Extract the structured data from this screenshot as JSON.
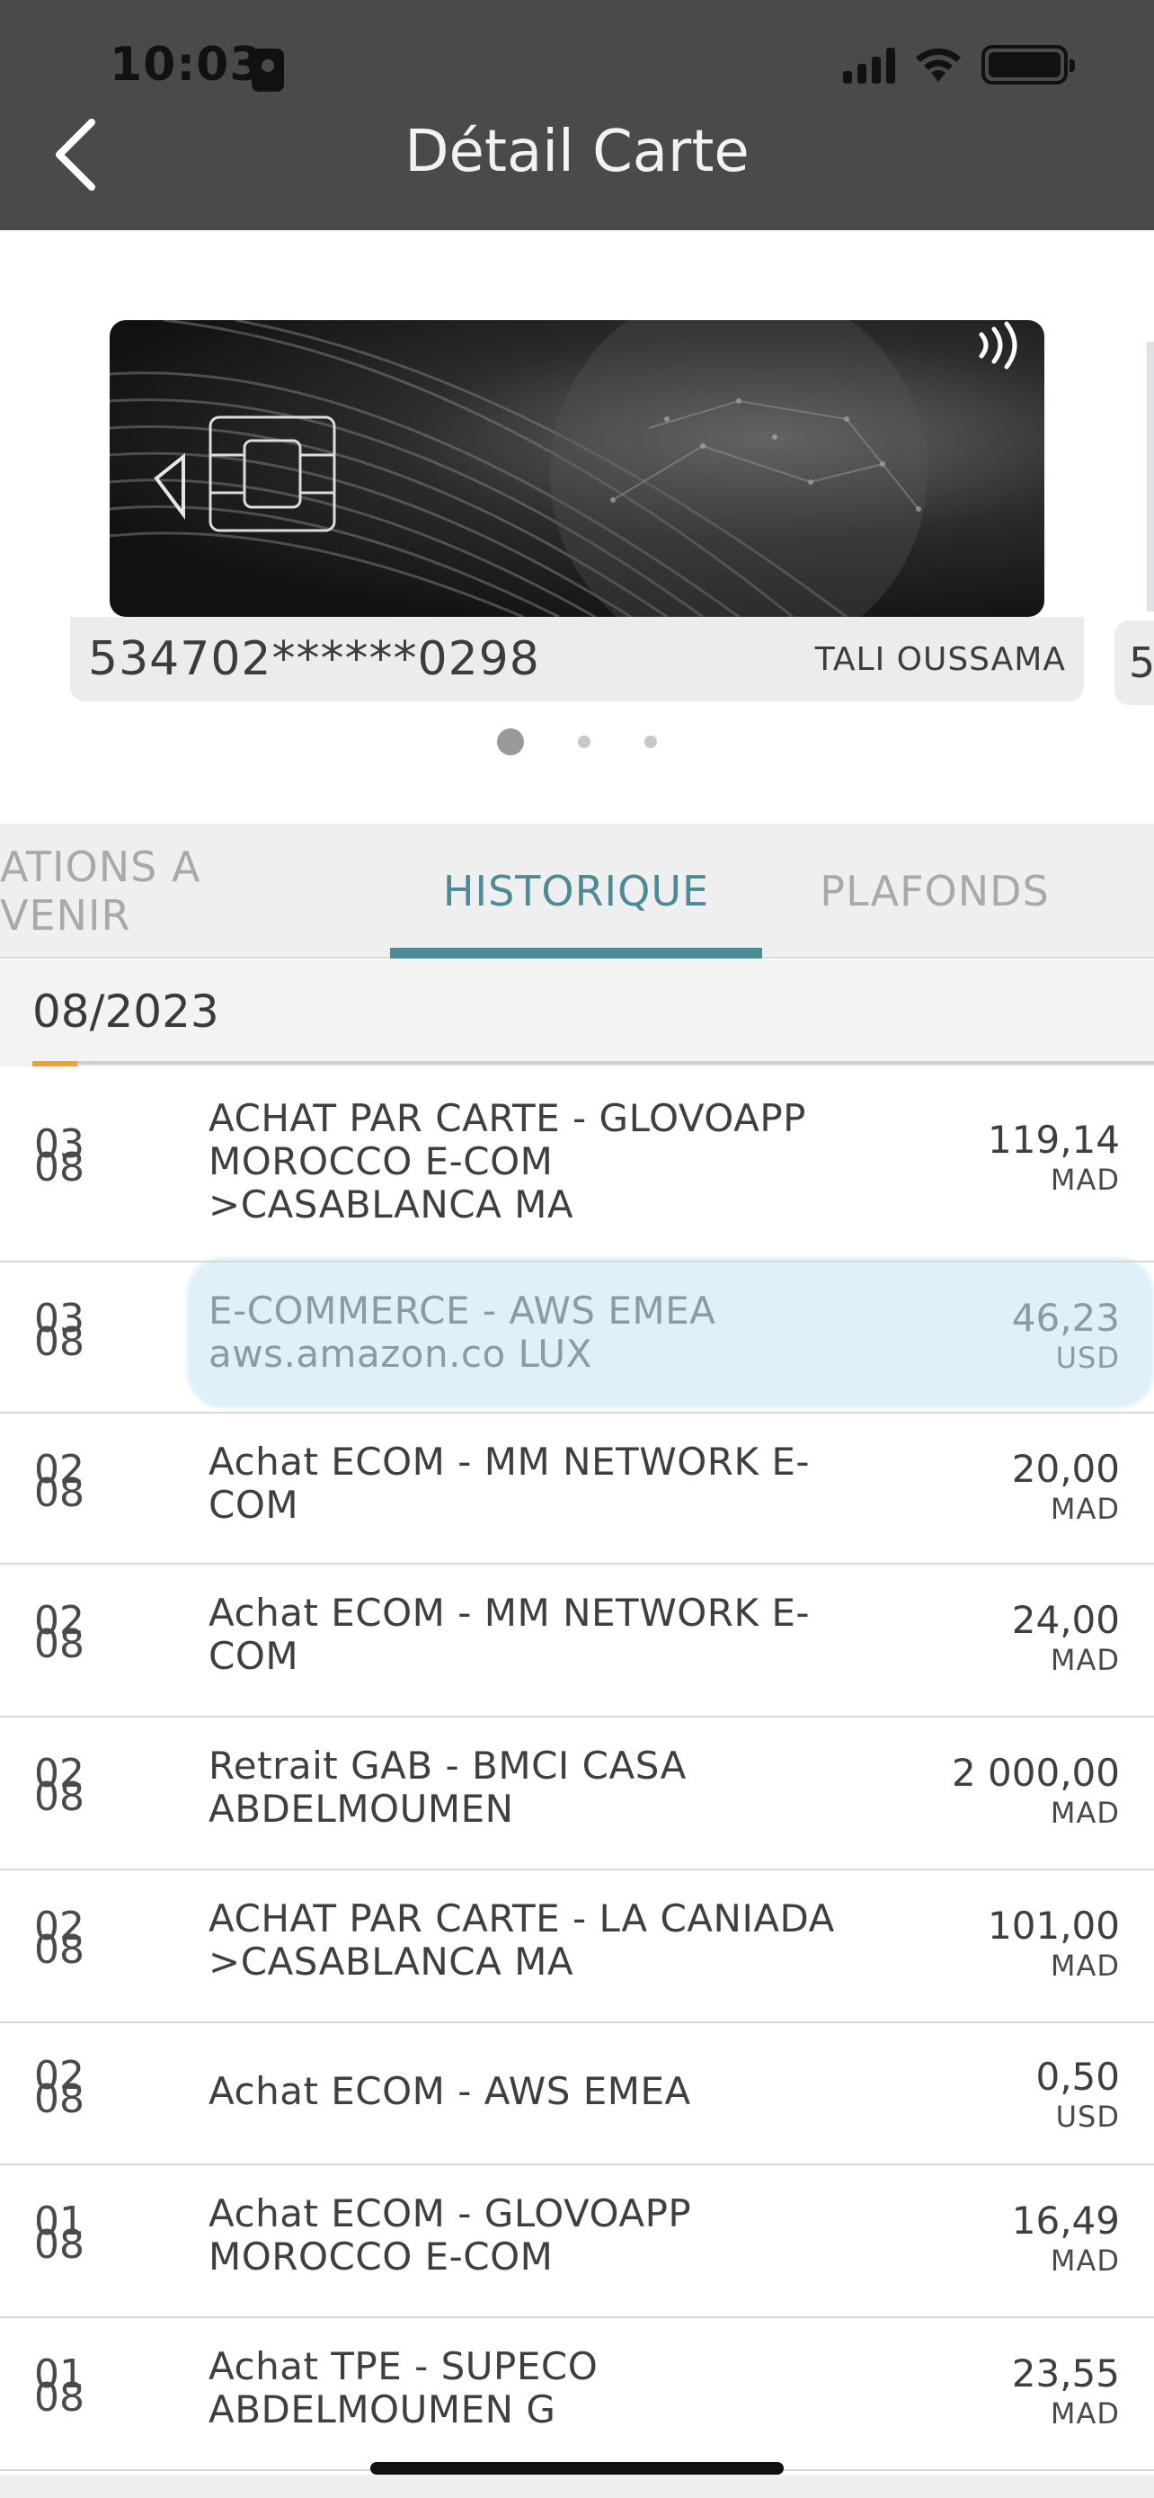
{
  "status_bar": {
    "time": "10:03"
  },
  "header": {
    "title": "Détail Carte"
  },
  "card": {
    "number": "534702******0298",
    "holder": "TALI OUSSAMA",
    "next_card_peek": "5"
  },
  "carousel": {
    "pages": 3,
    "active": 1
  },
  "tabs": [
    {
      "label": "ATIONS A VENIR",
      "active": false
    },
    {
      "label": "HISTORIQUE",
      "active": true
    },
    {
      "label": "PLAFONDS",
      "active": false
    }
  ],
  "section": {
    "period": "08/2023"
  },
  "transactions": [
    {
      "day": "03",
      "month": "08",
      "description": "ACHAT PAR CARTE - GLOVOAPP MOROCCO E-COM  >CASABLANCA MA",
      "amount": "119,14",
      "currency": "MAD"
    },
    {
      "day": "03",
      "month": "08",
      "description": "E-COMMERCE - AWS EMEA aws.amazon.co LUX",
      "amount": "46,23",
      "currency": "USD"
    },
    {
      "day": "02",
      "month": "08",
      "description": "Achat ECOM - MM NETWORK E-COM",
      "amount": "20,00",
      "currency": "MAD"
    },
    {
      "day": "02",
      "month": "08",
      "description": "Achat ECOM - MM NETWORK E-COM",
      "amount": "24,00",
      "currency": "MAD"
    },
    {
      "day": "02",
      "month": "08",
      "description": "Retrait GAB - BMCI CASA ABDELMOUMEN",
      "amount": "2 000,00",
      "currency": "MAD"
    },
    {
      "day": "02",
      "month": "08",
      "description": "ACHAT PAR CARTE - LA CANIADA >CASABLANCA   MA",
      "amount": "101,00",
      "currency": "MAD"
    },
    {
      "day": "02",
      "month": "08",
      "description": "Achat ECOM - AWS EMEA",
      "amount": "0,50",
      "currency": "USD"
    },
    {
      "day": "01",
      "month": "08",
      "description": "Achat ECOM - GLOVOAPP MOROCCO E-COM",
      "amount": "16,49",
      "currency": "MAD"
    },
    {
      "day": "01",
      "month": "08",
      "description": "Achat TPE - SUPECO ABDELMOUMEN G",
      "amount": "23,55",
      "currency": "MAD"
    }
  ],
  "colors": {
    "header_bg": "#4a4a4a",
    "accent_tab": "#4d8a97",
    "section_accent": "#e9a23b"
  }
}
